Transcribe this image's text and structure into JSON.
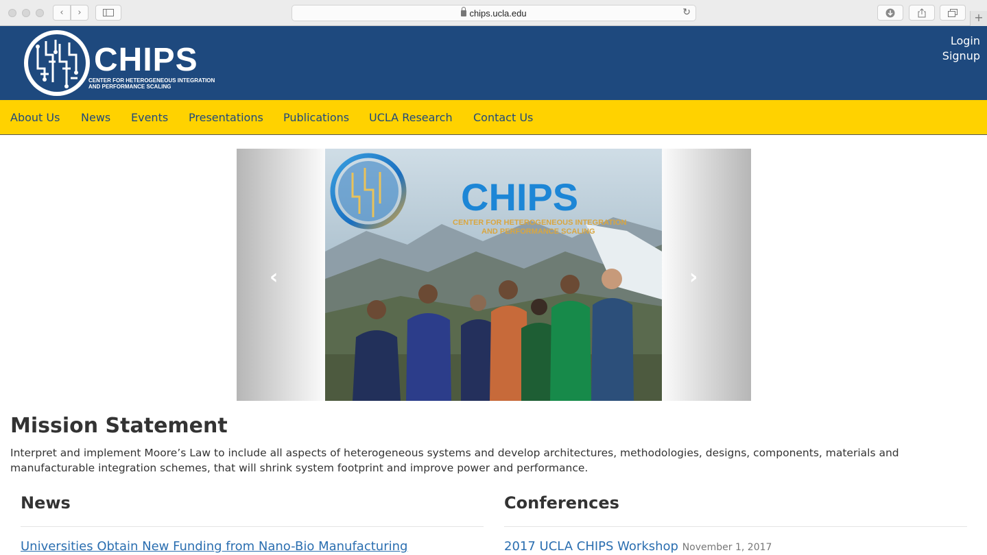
{
  "browser": {
    "url": "chips.ucla.edu",
    "new_tab": "+"
  },
  "header": {
    "logo_word": "CHIPS",
    "logo_subtitle_line1": "CENTER FOR HETEROGENEOUS INTEGRATION",
    "logo_subtitle_line2": "AND PERFORMANCE SCALING",
    "login": "Login",
    "signup": "Signup",
    "colors": {
      "header_bg": "#1e497e",
      "nav_bg": "#ffd200",
      "nav_text": "#1e497e",
      "link": "#2a6eb0"
    }
  },
  "nav": {
    "items": [
      {
        "label": "About Us"
      },
      {
        "label": "News"
      },
      {
        "label": "Events"
      },
      {
        "label": "Presentations"
      },
      {
        "label": "Publications"
      },
      {
        "label": "UCLA Research"
      },
      {
        "label": "Contact Us"
      }
    ]
  },
  "carousel": {
    "slide_title": "CHIPS",
    "slide_subtitle_line1": "CENTER FOR HETEROGENEOUS INTEGRATION",
    "slide_subtitle_line2": "AND PERFORMANCE SCALING",
    "prev_icon": "chevron-left-icon",
    "next_icon": "chevron-right-icon"
  },
  "mission": {
    "title": "Mission Statement",
    "text": "Interpret and implement Moore’s Law to include all aspects of heterogeneous systems and develop architectures, methodologies, designs, components, materials and manufacturable integration schemes, that will shrink system footprint and improve power and performance."
  },
  "news": {
    "title": "News",
    "first_item": "Universities Obtain New Funding from Nano-Bio Manufacturing"
  },
  "conferences": {
    "title": "Conferences",
    "first_item": "2017 UCLA CHIPS Workshop",
    "first_item_date": "November 1, 2017"
  }
}
